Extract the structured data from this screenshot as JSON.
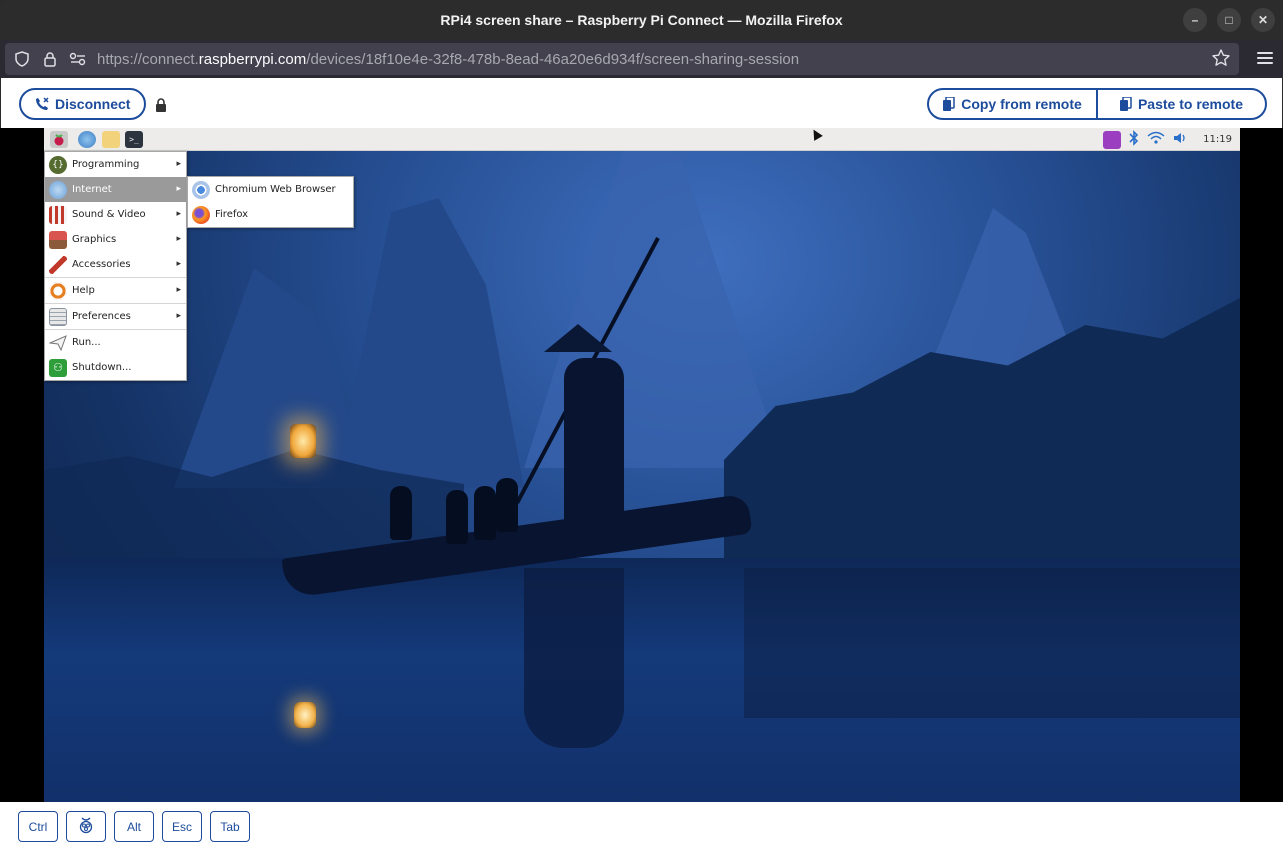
{
  "window": {
    "title": "RPi4 screen share – Raspberry Pi Connect — Mozilla Firefox"
  },
  "urlbar": {
    "prefix": "https://connect.",
    "host": "raspberrypi.com",
    "path": "/devices/18f10e4e-32f8-478b-8ead-46a20e6d934f/screen-sharing-session"
  },
  "toolbar": {
    "disconnect_label": "Disconnect",
    "copy_from_remote_label": "Copy from remote",
    "paste_to_remote_label": "Paste to remote"
  },
  "remote": {
    "clock": "11:19",
    "main_menu": [
      {
        "label": "Programming",
        "icon": "programming-icon",
        "submenu": true
      },
      {
        "label": "Internet",
        "icon": "internet-icon",
        "submenu": true,
        "active": true
      },
      {
        "label": "Sound & Video",
        "icon": "sound-video-icon",
        "submenu": true
      },
      {
        "label": "Graphics",
        "icon": "graphics-icon",
        "submenu": true
      },
      {
        "label": "Accessories",
        "icon": "accessories-icon",
        "submenu": true
      },
      {
        "label": "Help",
        "icon": "help-icon",
        "submenu": true
      },
      {
        "label": "Preferences",
        "icon": "preferences-icon",
        "submenu": true
      },
      {
        "label": "Run...",
        "icon": "run-icon",
        "submenu": false
      },
      {
        "label": "Shutdown...",
        "icon": "shutdown-icon",
        "submenu": false
      }
    ],
    "internet_submenu": [
      {
        "label": "Chromium Web Browser",
        "icon": "chromium-icon"
      },
      {
        "label": "Firefox",
        "icon": "firefox-icon"
      }
    ]
  },
  "keys": {
    "ctrl": "Ctrl",
    "alt": "Alt",
    "esc": "Esc",
    "tab": "Tab"
  },
  "colors": {
    "accent": "#1c4c9b",
    "menu_highlight": "#9a9a9a"
  }
}
